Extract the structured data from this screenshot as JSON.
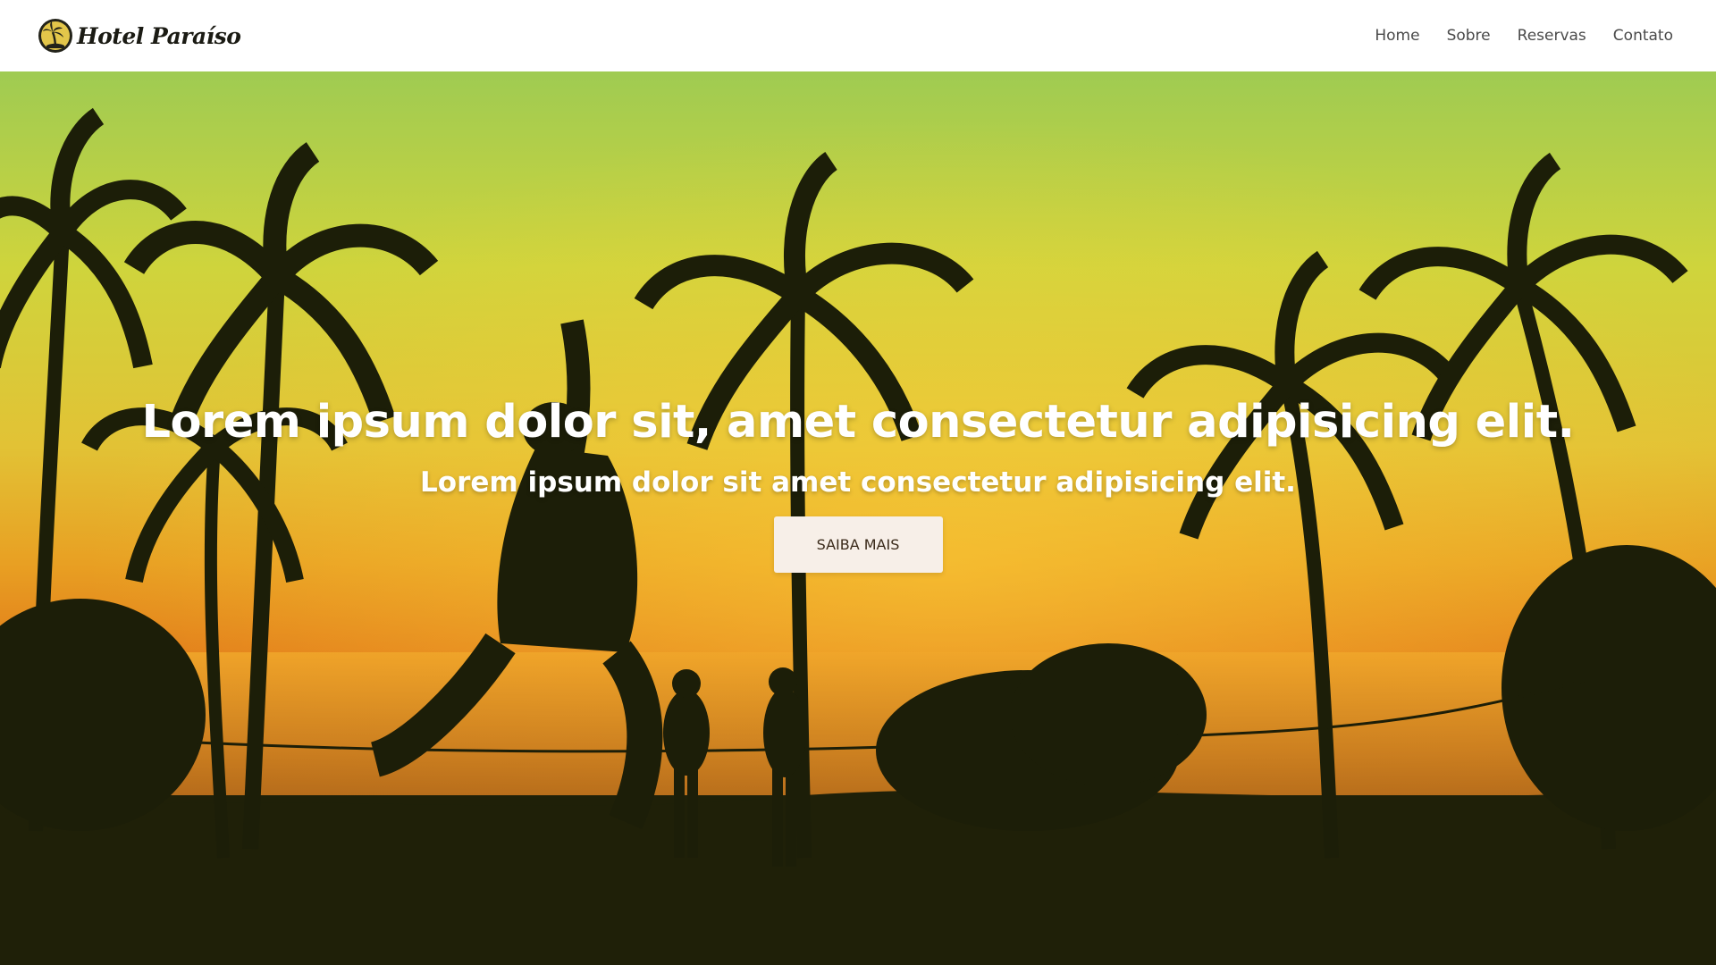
{
  "brand": {
    "name": "Hotel Paraíso",
    "logo_icon": "palm-tree-logo-icon"
  },
  "nav": {
    "items": [
      {
        "label": "Home"
      },
      {
        "label": "Sobre"
      },
      {
        "label": "Reservas"
      },
      {
        "label": "Contato"
      }
    ]
  },
  "hero": {
    "title": "Lorem ipsum dolor sit, amet consectetur adipisicing elit.",
    "subtitle": "Lorem ipsum dolor sit amet consectetur adipisicing elit.",
    "button_label": "SAIBA MAIS",
    "background": "sunset-beach-palm-trees-slackline-photo"
  },
  "colors": {
    "navbar_bg": "#ffffff",
    "sky_top": "#9cc94f",
    "sky_mid": "#d9d43a",
    "sky_low": "#e98d1a",
    "ground": "#1f2008",
    "button_bg": "#f7efe8"
  }
}
